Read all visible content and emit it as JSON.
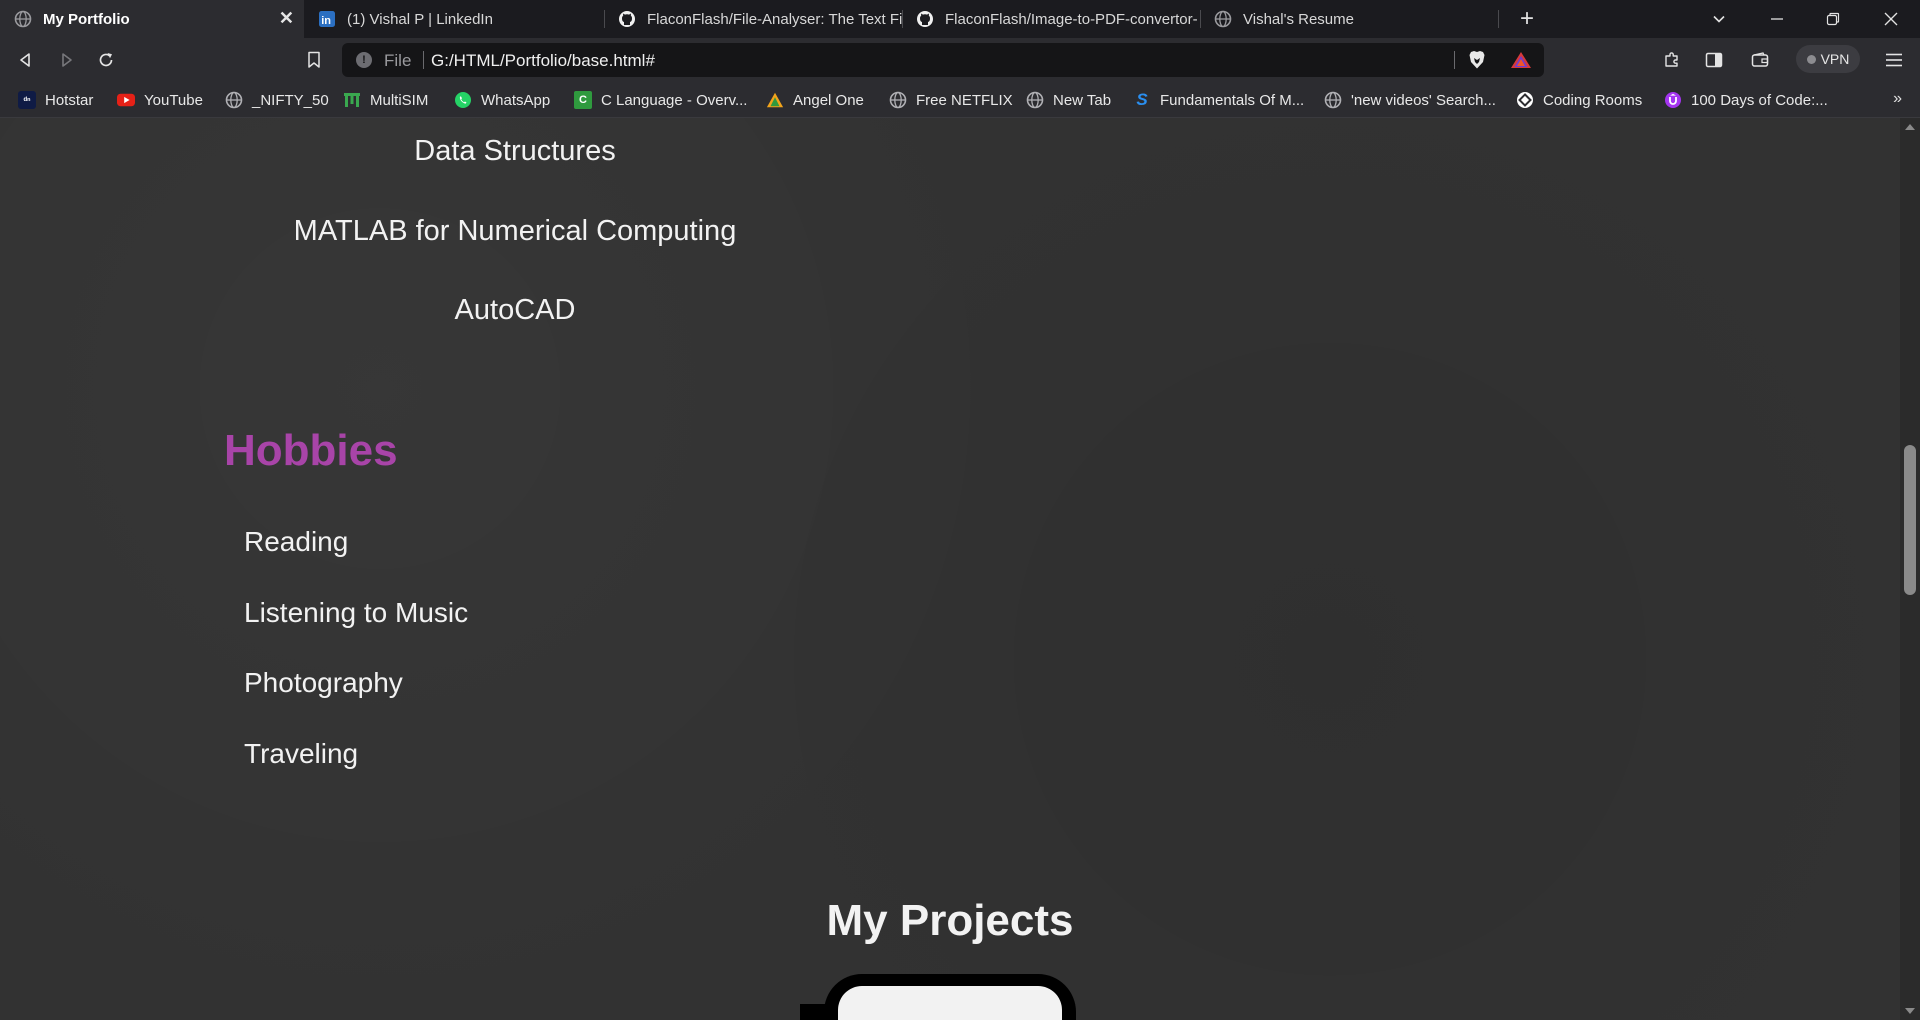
{
  "browser": {
    "tabs": [
      {
        "title": "My Portfolio",
        "icon": "globe-icon",
        "active": true
      },
      {
        "title": "(1) Vishal P | LinkedIn",
        "icon": "linkedin-icon",
        "active": false
      },
      {
        "title": "FlaconFlash/File-Analyser: The Text File",
        "icon": "github-icon",
        "active": false
      },
      {
        "title": "FlaconFlash/Image-to-PDF-convertor-",
        "icon": "github-icon",
        "active": false
      },
      {
        "title": "Vishal's Resume",
        "icon": "globe-icon",
        "active": false
      }
    ],
    "new_tab_symbol": "+",
    "address_bar": {
      "scheme_label": "File",
      "url": "G:/HTML/Portfolio/base.html#"
    },
    "vpn_label": "VPN",
    "bookmarks": [
      {
        "label": "Hotstar",
        "icon": "hotstar-icon"
      },
      {
        "label": "YouTube",
        "icon": "youtube-icon"
      },
      {
        "label": "_NIFTY_50",
        "icon": "globe-icon"
      },
      {
        "label": "MultiSIM",
        "icon": "multisim-icon"
      },
      {
        "label": "WhatsApp",
        "icon": "whatsapp-icon"
      },
      {
        "label": "C Language - Overv...",
        "icon": "c-language-icon"
      },
      {
        "label": "Angel One",
        "icon": "angel-one-icon"
      },
      {
        "label": "Free NETFLIX",
        "icon": "globe-icon"
      },
      {
        "label": "New Tab",
        "icon": "globe-icon"
      },
      {
        "label": "Fundamentals Of M...",
        "icon": "s-logo-icon"
      },
      {
        "label": "'new videos' Search...",
        "icon": "globe-icon"
      },
      {
        "label": "Coding Rooms",
        "icon": "coding-rooms-icon"
      },
      {
        "label": "100 Days of Code:...",
        "icon": "udemy-icon"
      }
    ],
    "bookmarks_overflow": "»",
    "colors": {
      "tabstrip": "#1b1b1f",
      "toolbar": "#2c2c30",
      "omnibox": "#151517"
    }
  },
  "page": {
    "skills": [
      "Data Structures",
      "MATLAB for Numerical Computing",
      "AutoCAD"
    ],
    "hobbies_title": "Hobbies",
    "hobbies": [
      "Reading",
      "Listening to Music",
      "Photography",
      "Traveling"
    ],
    "projects_title": "My Projects",
    "colors": {
      "background": "#323232",
      "text": "#f2f2f2",
      "accent": "#a844a8"
    }
  }
}
